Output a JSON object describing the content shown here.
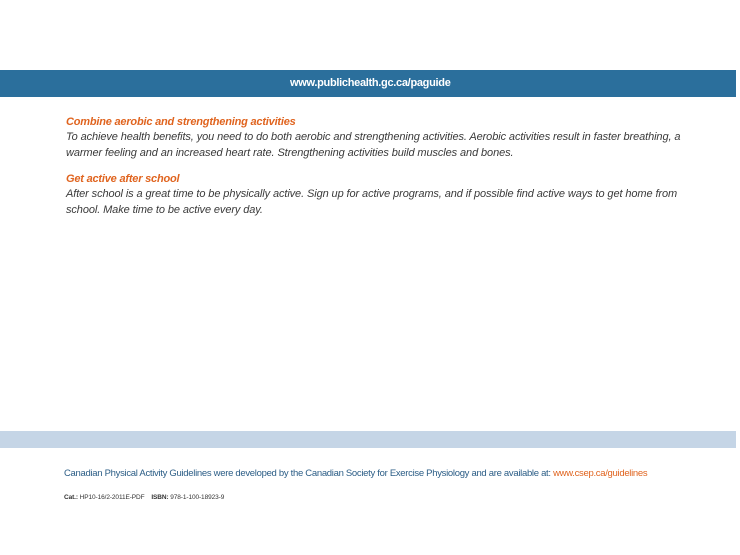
{
  "header": {
    "url": "www.publichealth.gc.ca/paguide",
    "bar_color": "#2b6f9c"
  },
  "tips": [
    {
      "heading": "Combine aerobic and strengthening activities",
      "body": "To achieve health benefits, you need to do both aerobic and strengthening activities. Aerobic activities result in faster breathing, a warmer feeling and an increased heart rate. Strengthening activities build muscles and bones."
    },
    {
      "heading": "Get active after school",
      "body": "After school is a great time to be physically active. Sign up for active programs, and if possible find active ways to get home from school. Make time to be active every day."
    }
  ],
  "footer": {
    "text": "Canadian Physical Activity Guidelines were developed by the Canadian Society for Exercise Physiology and are available at: ",
    "link": "www.csep.ca/guidelines",
    "band_color": "#c5d5e6",
    "text_color": "#2b5d86",
    "accent_color": "#e0641f"
  },
  "catalogue": {
    "cat_label": "Cat.:",
    "cat_value": "HP10-16/2-2011E-PDF",
    "isbn_label": "ISBN:",
    "isbn_value": "978-1-100-18923-9"
  }
}
